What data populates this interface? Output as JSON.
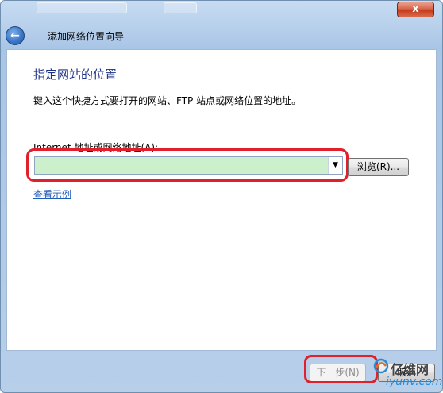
{
  "window": {
    "close_label": "x",
    "title": "添加网络位置向导"
  },
  "main": {
    "heading": "指定网站的位置",
    "description": "键入这个快捷方式要打开的网站、FTP 站点或网络位置的地址。",
    "field_label": "Internet 地址或网络地址(A):",
    "address_value": "",
    "browse_label": "浏览(R)...",
    "example_link": "查看示例"
  },
  "footer": {
    "next_label": "下一步(N)",
    "cancel_label": "取消"
  },
  "watermark": {
    "top": "亿维网",
    "bottom": "iyunv.com"
  },
  "colors": {
    "heading": "#1e3287",
    "link": "#1e5bb8",
    "highlight": "#e0202a",
    "input_fill": "#ccefcc"
  }
}
